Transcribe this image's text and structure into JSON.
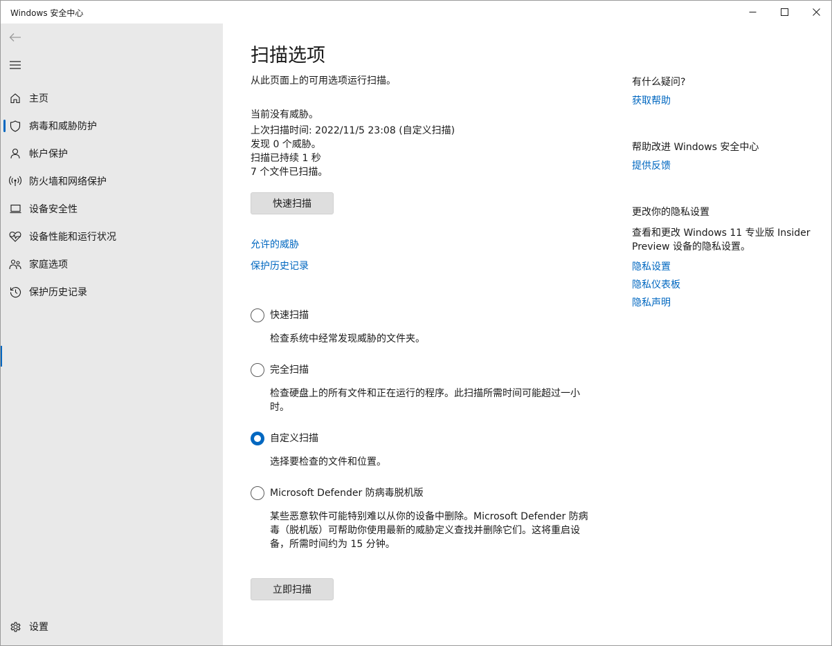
{
  "window": {
    "title": "Windows 安全中心"
  },
  "sidebar": {
    "items": [
      {
        "label": "主页",
        "icon": "home-icon"
      },
      {
        "label": "病毒和威胁防护",
        "icon": "shield-icon"
      },
      {
        "label": "帐户保护",
        "icon": "person-icon"
      },
      {
        "label": "防火墙和网络保护",
        "icon": "wireless-icon"
      },
      {
        "label": "设备安全性",
        "icon": "laptop-icon"
      },
      {
        "label": "设备性能和运行状况",
        "icon": "heart-pulse-icon"
      },
      {
        "label": "家庭选项",
        "icon": "family-icon"
      },
      {
        "label": "保护历史记录",
        "icon": "history-icon"
      }
    ],
    "active_index": 1,
    "settings_label": "设置"
  },
  "main": {
    "title": "扫描选项",
    "subtitle": "从此页面上的可用选项运行扫描。",
    "status": {
      "no_threats": "当前没有威胁。",
      "last_scan": "上次扫描时间: 2022/11/5 23:08 (自定义扫描)",
      "found": "发现 0 个威胁。",
      "duration": "扫描已持续 1 秒",
      "files": "7 个文件已扫描。"
    },
    "quick_scan_button": "快速扫描",
    "allowed_threats_link": "允许的威胁",
    "protection_history_link": "保护历史记录",
    "options": [
      {
        "title": "快速扫描",
        "desc": "检查系统中经常发现威胁的文件夹。",
        "checked": false
      },
      {
        "title": "完全扫描",
        "desc": "检查硬盘上的所有文件和正在运行的程序。此扫描所需时间可能超过一小时。",
        "checked": false
      },
      {
        "title": "自定义扫描",
        "desc": "选择要检查的文件和位置。",
        "checked": true
      },
      {
        "title": "Microsoft Defender 防病毒脱机版",
        "desc": "某些恶意软件可能特别难以从你的设备中删除。Microsoft Defender 防病毒（脱机版）可帮助你使用最新的威胁定义查找并删除它们。这将重启设备，所需时间约为 15 分钟。",
        "checked": false
      }
    ],
    "scan_now_button": "立即扫描"
  },
  "right_panel": {
    "question_heading": "有什么疑问?",
    "get_help_link": "获取帮助",
    "improve_heading": "帮助改进 Windows 安全中心",
    "feedback_link": "提供反馈",
    "privacy_heading": "更改你的隐私设置",
    "privacy_text": "查看和更改 Windows 11 专业版 Insider Preview 设备的隐私设置。",
    "privacy_settings_link": "隐私设置",
    "privacy_dashboard_link": "隐私仪表板",
    "privacy_statement_link": "隐私声明"
  },
  "colors": {
    "accent": "#0067c0",
    "sidebar_bg": "#e9e9e9"
  }
}
